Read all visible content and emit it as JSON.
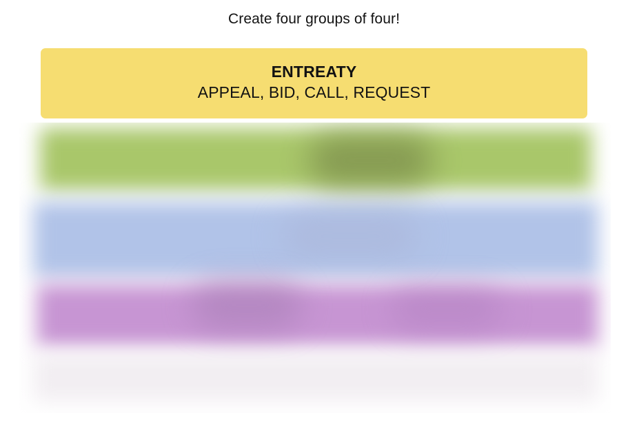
{
  "instructions": "Create four groups of four!",
  "solved_groups": [
    {
      "title": "ENTREATY",
      "members": "APPEAL, BID, CALL, REQUEST",
      "color": "#f6dd71"
    }
  ],
  "hidden_rows": {
    "colors": [
      "#a9c76a",
      "#b1c3e8",
      "#c795d3",
      "#f2eef2"
    ]
  }
}
